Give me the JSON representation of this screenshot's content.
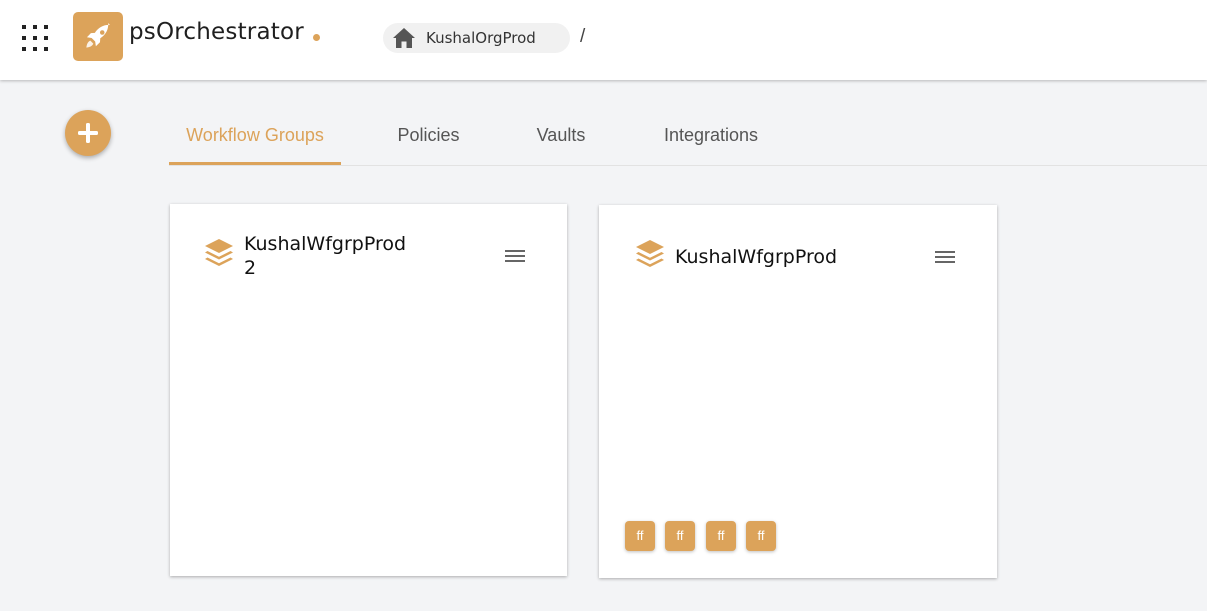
{
  "header": {
    "app_name": "psOrchestrator",
    "breadcrumb": {
      "org": "KushalOrgProd",
      "separator": "/"
    },
    "icons": {
      "apps": "apps-grid-icon",
      "logo": "rocket-icon",
      "home": "home-icon"
    }
  },
  "toolbar": {
    "add_icon": "plus-icon"
  },
  "tabs": [
    {
      "label": "Workflow Groups",
      "active": true
    },
    {
      "label": "Policies",
      "active": false
    },
    {
      "label": "Vaults",
      "active": false
    },
    {
      "label": "Integrations",
      "active": false
    }
  ],
  "cards": [
    {
      "title_line1": "KushalWfgrpProd",
      "title_line2": "2",
      "tags": []
    },
    {
      "title": "KushalWfgrpProd",
      "tags": [
        "ff",
        "ff",
        "ff",
        "ff"
      ]
    }
  ],
  "colors": {
    "accent": "#dca35a",
    "background": "#f3f4f6"
  }
}
